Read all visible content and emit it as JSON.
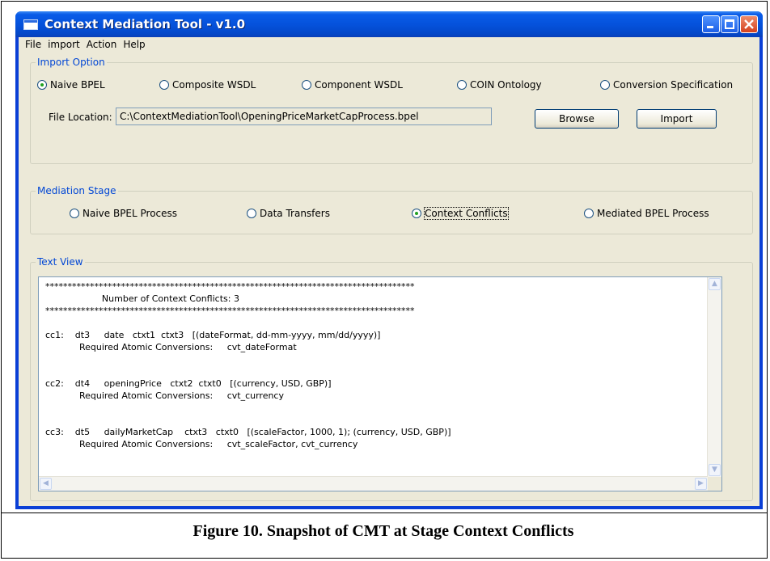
{
  "window": {
    "title": "Context Mediation Tool - v1.0"
  },
  "menu": [
    "File",
    "import",
    "Action",
    "Help"
  ],
  "import_option": {
    "legend": "Import Option",
    "radios": [
      {
        "label": "Naive BPEL",
        "checked": true
      },
      {
        "label": "Composite WSDL",
        "checked": false
      },
      {
        "label": "Component WSDL",
        "checked": false
      },
      {
        "label": "COIN Ontology",
        "checked": false
      },
      {
        "label": "Conversion Specification",
        "checked": false
      }
    ],
    "file_location_label": "File Location:",
    "file_location_value": "C:\\ContextMediationTool\\OpeningPriceMarketCapProcess.bpel",
    "browse_label": "Browse",
    "import_label": "Import"
  },
  "mediation_stage": {
    "legend": "Mediation Stage",
    "radios": [
      {
        "label": "Naive BPEL Process",
        "checked": false
      },
      {
        "label": "Data Transfers",
        "checked": false
      },
      {
        "label": "Context Conflicts",
        "checked": true
      },
      {
        "label": "Mediated BPEL Process",
        "checked": false
      }
    ]
  },
  "text_view": {
    "legend": "Text View",
    "content": "***********************************************************************************\n                    Number of Context Conflicts: 3\n***********************************************************************************\n\ncc1:    dt3     date   ctxt1  ctxt3   [(dateFormat, dd-mm-yyyy, mm/dd/yyyy)]\n            Required Atomic Conversions:     cvt_dateFormat\n\n\ncc2:    dt4     openingPrice   ctxt2  ctxt0   [(currency, USD, GBP)]\n            Required Atomic Conversions:     cvt_currency\n\n\ncc3:    dt5     dailyMarketCap    ctxt3   ctxt0   [(scaleFactor, 1000, 1); (currency, USD, GBP)]\n            Required Atomic Conversions:     cvt_scaleFactor, cvt_currency"
  },
  "caption": "Figure 10.  Snapshot of CMT at Stage Context Conflicts"
}
